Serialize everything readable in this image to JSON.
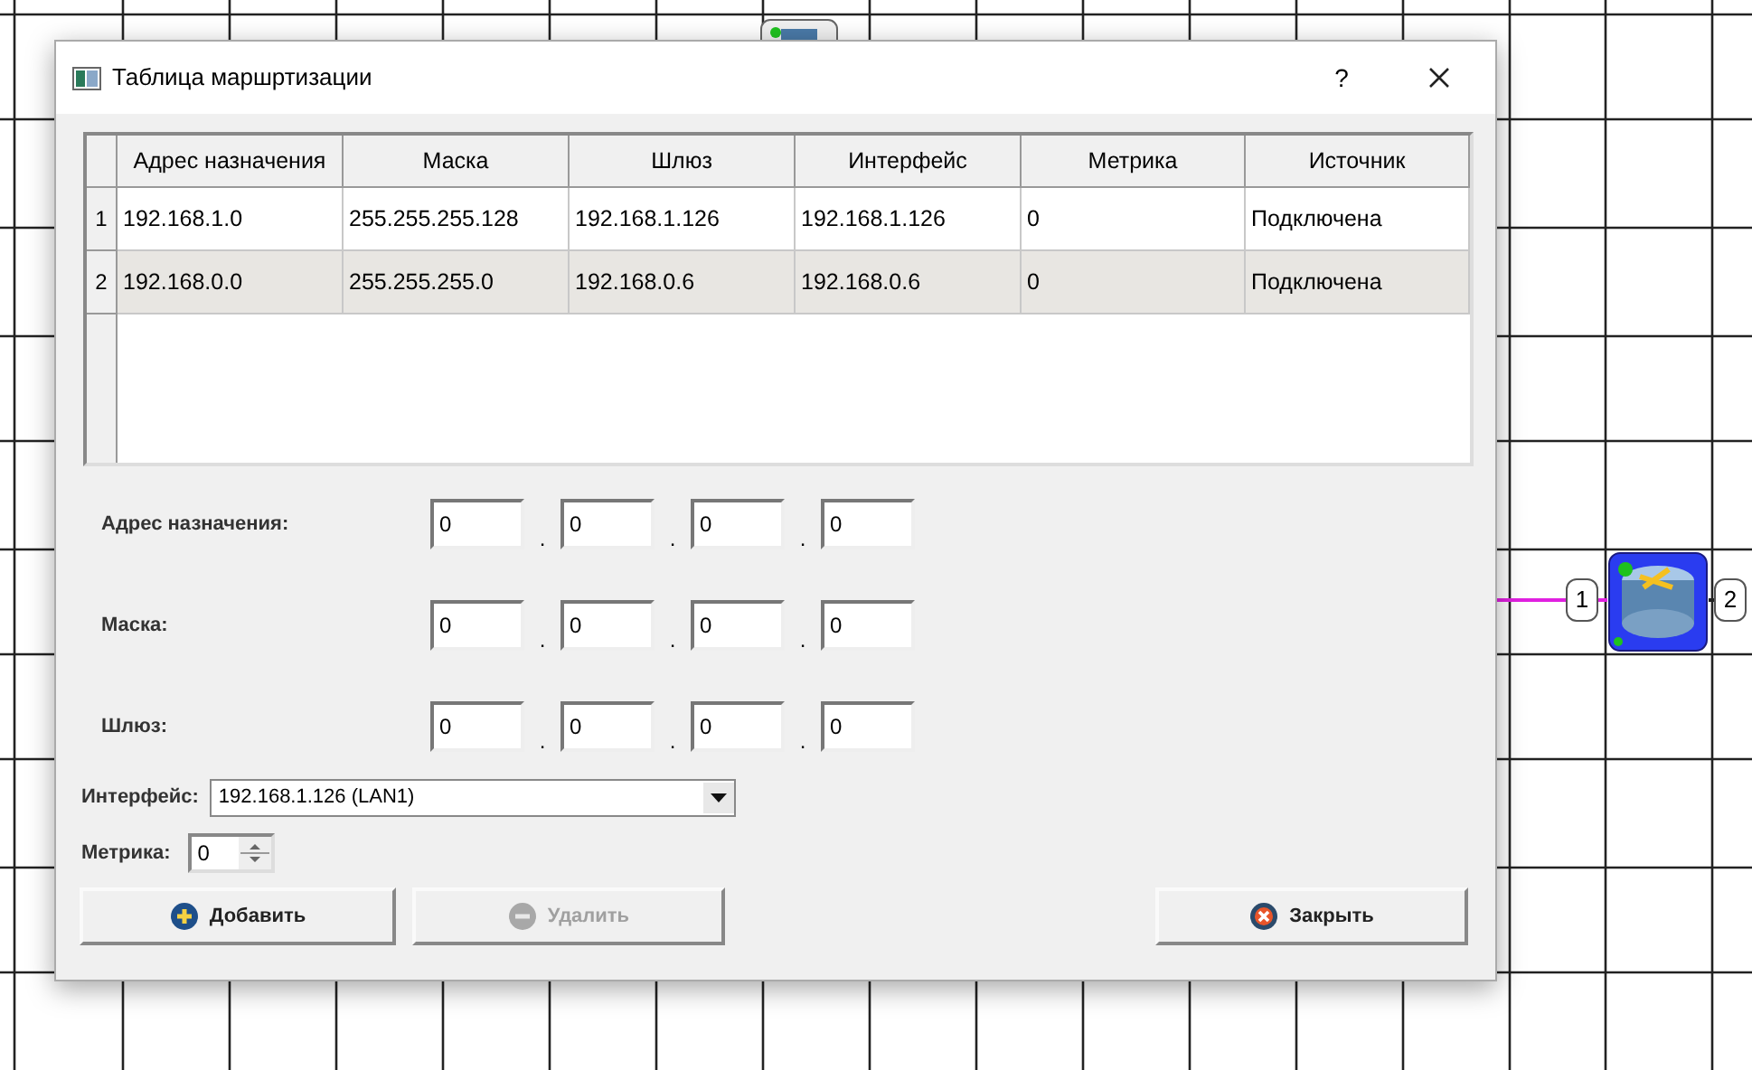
{
  "dialog": {
    "title": "Таблица маршртизации",
    "help": "?"
  },
  "table": {
    "columns": [
      "Адрес назначения",
      "Маска",
      "Шлюз",
      "Интерфейс",
      "Метрика",
      "Источник"
    ],
    "rows": [
      {
        "number": "1",
        "cells": [
          "192.168.1.0",
          "255.255.255.128",
          "192.168.1.126",
          "192.168.1.126",
          "0",
          "Подключена"
        ]
      },
      {
        "number": "2",
        "cells": [
          "192.168.0.0",
          "255.255.255.0",
          "192.168.0.6",
          "192.168.0.6",
          "0",
          "Подключена"
        ]
      }
    ]
  },
  "ip_fields": [
    {
      "label": "Адрес назначения:",
      "octets": [
        "0",
        "0",
        "0",
        "0"
      ]
    },
    {
      "label": "Маска:",
      "octets": [
        "0",
        "0",
        "0",
        "0"
      ]
    },
    {
      "label": "Шлюз:",
      "octets": [
        "0",
        "0",
        "0",
        "0"
      ]
    }
  ],
  "separator": ".",
  "interface": {
    "label": "Интерфейс:",
    "value": "192.168.1.126 (LAN1)"
  },
  "metric": {
    "label": "Метрика:",
    "value": "0"
  },
  "buttons": [
    {
      "label": "Добавить",
      "kind": "add",
      "disabled": false
    },
    {
      "label": "Удалить",
      "kind": "remove",
      "disabled": true
    },
    {
      "label": "Закрыть",
      "kind": "close",
      "disabled": false
    }
  ],
  "canvas": {
    "ports": [
      "1",
      "2"
    ]
  }
}
